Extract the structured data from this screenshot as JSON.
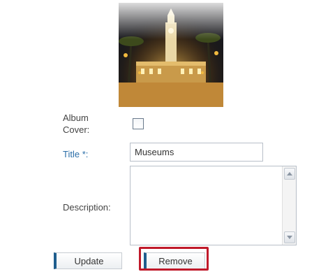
{
  "album_cover": {
    "label": "Album\nCover:",
    "checked": false
  },
  "title_field": {
    "label": "Title *:",
    "value": "Museums"
  },
  "description_field": {
    "label": "Description:",
    "value": ""
  },
  "buttons": {
    "update": "Update",
    "remove": "Remove"
  },
  "colors": {
    "title_label": "#2b6ea8",
    "highlight": "#c0192a",
    "button_accent": "#1f5e8e"
  }
}
